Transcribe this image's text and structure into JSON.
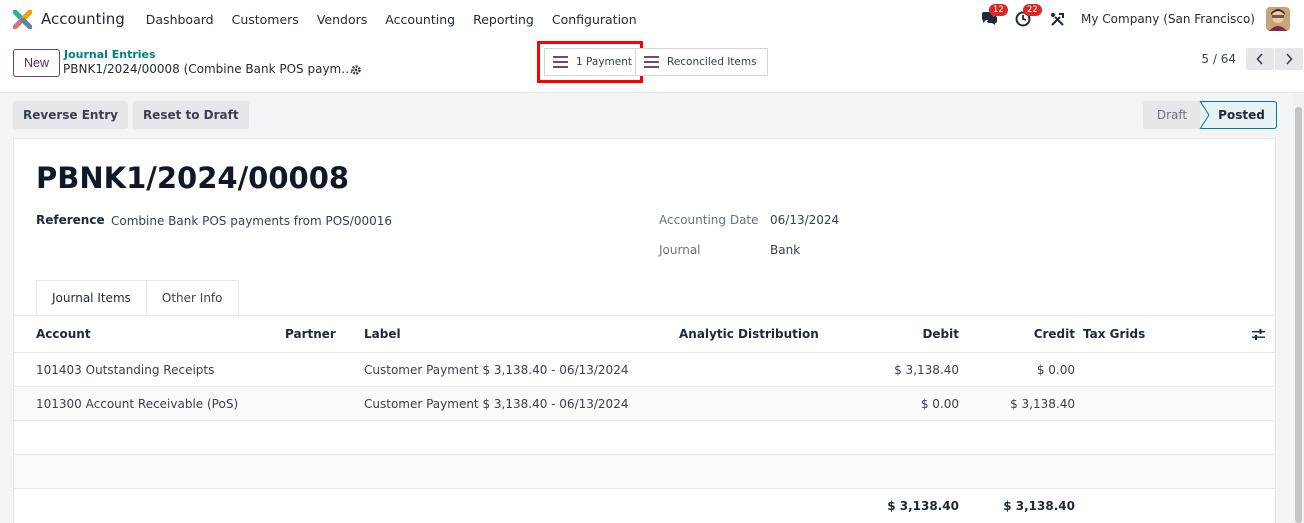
{
  "navbar": {
    "brand": "Accounting",
    "menu": [
      "Dashboard",
      "Customers",
      "Vendors",
      "Accounting",
      "Reporting",
      "Configuration"
    ],
    "messages_count": "12",
    "activities_count": "22",
    "company": "My Company (San Francisco)"
  },
  "control": {
    "new_label": "New",
    "breadcrumb_parent": "Journal Entries",
    "breadcrumb_current": "PBNK1/2024/00008 (Combine Bank POS paym…",
    "payment_button": "1 Payment",
    "reconciled_button": "Reconciled Items",
    "pager": "5 / 64"
  },
  "statusbar": {
    "reverse_entry": "Reverse Entry",
    "reset_to_draft": "Reset to Draft",
    "stages": [
      "Draft",
      "Posted"
    ],
    "current_stage": "Posted"
  },
  "form": {
    "title": "PBNK1/2024/00008",
    "reference_label": "Reference",
    "reference_value": "Combine Bank POS payments from POS/00016",
    "accounting_date_label": "Accounting Date",
    "accounting_date_value": "06/13/2024",
    "journal_label": "Journal",
    "journal_value": "Bank",
    "tabs": [
      "Journal Items",
      "Other Info"
    ]
  },
  "table": {
    "columns": {
      "account": "Account",
      "partner": "Partner",
      "label": "Label",
      "analytic": "Analytic Distribution",
      "debit": "Debit",
      "credit": "Credit",
      "tax_grids": "Tax Grids"
    },
    "rows": [
      {
        "account": "101403 Outstanding Receipts",
        "partner": "",
        "label": "Customer Payment $ 3,138.40 - 06/13/2024",
        "debit": "$ 3,138.40",
        "credit": "$ 0.00"
      },
      {
        "account": "101300 Account Receivable (PoS)",
        "partner": "",
        "label": "Customer Payment $ 3,138.40 - 06/13/2024",
        "debit": "$ 0.00",
        "credit": "$ 3,138.40"
      }
    ],
    "totals": {
      "debit": "$ 3,138.40",
      "credit": "$ 3,138.40"
    }
  },
  "colors": {
    "brand": "#714b67",
    "teal": "#017e84",
    "highlight": "#ff0000",
    "badge": "#dc2626"
  },
  "icons": [
    "app-logo-icon",
    "chat-icon",
    "clock-icon",
    "tools-icon",
    "gear-icon",
    "hamburger-icon",
    "chevron-left-icon",
    "chevron-right-icon",
    "column-settings-icon"
  ]
}
